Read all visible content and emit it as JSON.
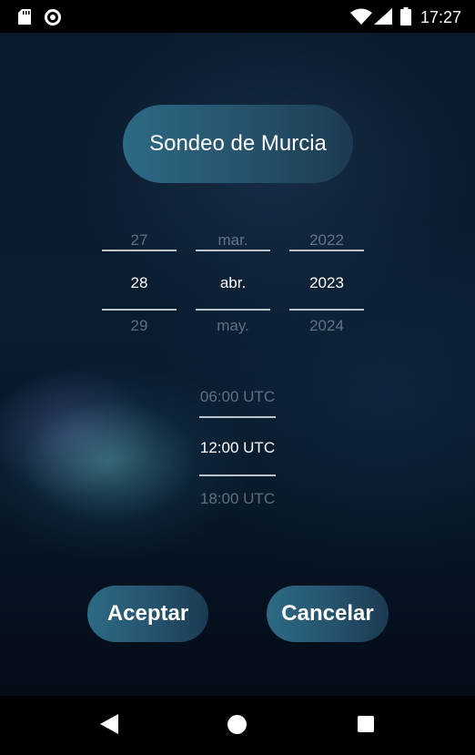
{
  "status_bar": {
    "time": "17:27",
    "icons": [
      "sd-card-icon",
      "record-icon",
      "wifi-icon",
      "signal-icon",
      "battery-icon"
    ]
  },
  "title": "Sondeo de Murcia",
  "date_picker": {
    "day": {
      "prev": "27",
      "selected": "28",
      "next": "29"
    },
    "month": {
      "prev": "mar.",
      "selected": "abr.",
      "next": "may."
    },
    "year": {
      "prev": "2022",
      "selected": "2023",
      "next": "2024"
    }
  },
  "time_picker": {
    "prev": "06:00 UTC",
    "selected": "12:00 UTC",
    "next": "18:00 UTC"
  },
  "buttons": {
    "accept": "Aceptar",
    "cancel": "Cancelar"
  },
  "colors": {
    "accent": "#2d6a85",
    "background": "#0a1c30"
  },
  "nav_bar": {
    "icons": [
      "back-icon",
      "home-icon",
      "recents-icon"
    ]
  }
}
